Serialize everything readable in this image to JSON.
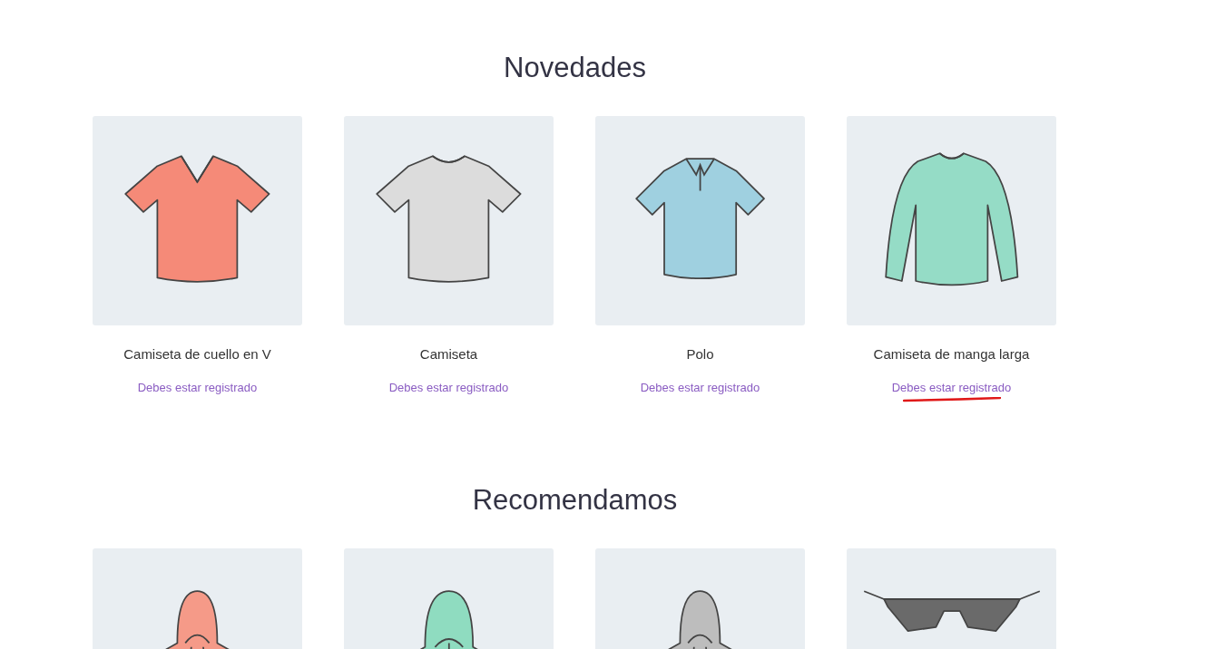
{
  "sections": [
    {
      "title": "Novedades",
      "products": [
        {
          "kind": "v-neck-tshirt",
          "color": "#f58a78",
          "name": "Camiseta de cuello en V",
          "link": "Debes estar registrado",
          "underlined": false
        },
        {
          "kind": "tshirt",
          "color": "#dcdcdc",
          "name": "Camiseta",
          "link": "Debes estar registrado",
          "underlined": false
        },
        {
          "kind": "polo",
          "color": "#9fd0e0",
          "name": "Polo",
          "link": "Debes estar registrado",
          "underlined": false
        },
        {
          "kind": "long-sleeve",
          "color": "#95dcc6",
          "name": "Camiseta de manga larga",
          "link": "Debes estar registrado",
          "underlined": true
        }
      ]
    },
    {
      "title": "Recomendamos",
      "products": [
        {
          "kind": "hoodie",
          "color": "#f59a88"
        },
        {
          "kind": "zip-hoodie",
          "color": "#8fdcc0"
        },
        {
          "kind": "hoodie",
          "color": "#bdbdbd"
        },
        {
          "kind": "sunglasses",
          "color": "#6a6a6a"
        }
      ]
    }
  ]
}
